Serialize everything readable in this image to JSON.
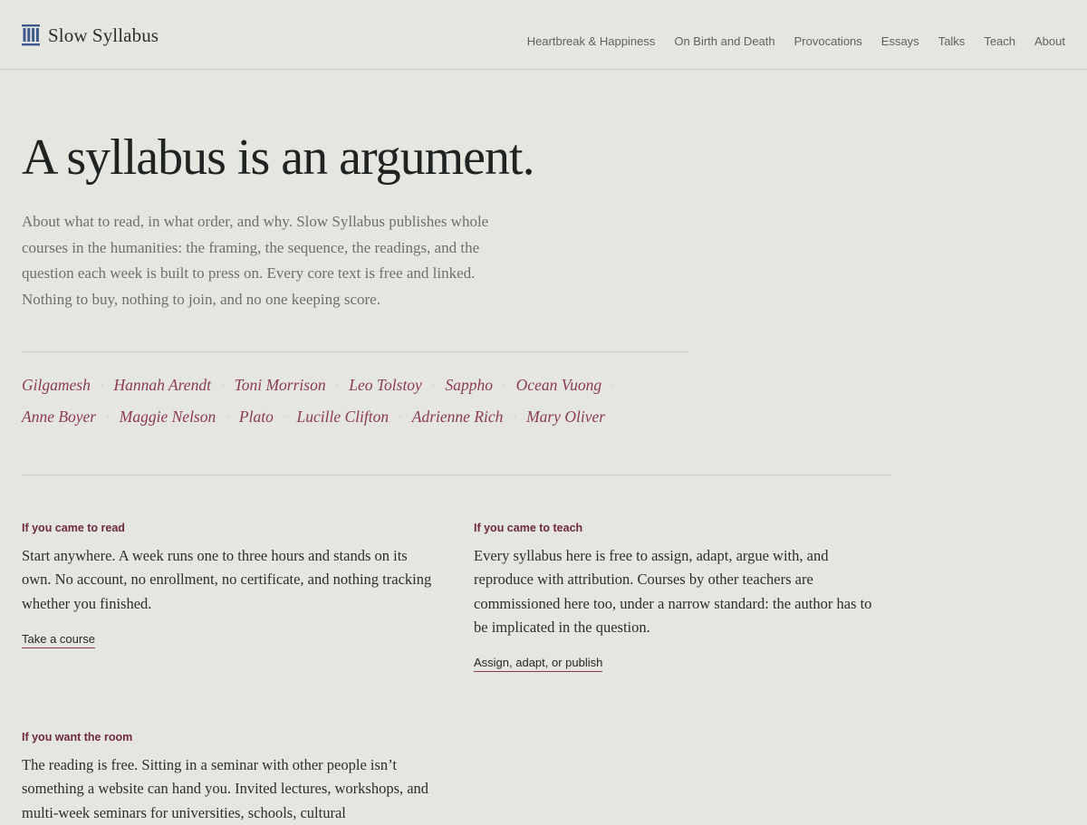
{
  "header": {
    "logo_text": "Slow Syllabus",
    "logo_icon": "columns-icon",
    "nav": [
      "Heartbreak & Happiness",
      "On Birth and Death",
      "Provocations",
      "Essays",
      "Talks",
      "Teach",
      "About"
    ]
  },
  "hero": {
    "title": "A syllabus is an argument.",
    "intro": "About what to read, in what order, and why. Slow Syllabus publishes whole courses in the humanities: the framing, the sequence, the readings, and the question each week is built to press on. Every core text is free and linked. Nothing to buy, nothing to join, and no one keeping score."
  },
  "authors": {
    "row1": [
      "Gilgamesh",
      "Hannah Arendt",
      "Toni Morrison",
      "Leo Tolstoy",
      "Sappho",
      "Ocean Vuong"
    ],
    "row2": [
      "Anne Boyer",
      "Maggie Nelson",
      "Plato",
      "Lucille Clifton",
      "Adrienne Rich",
      "Mary Oliver"
    ],
    "separator": "·"
  },
  "sections": {
    "read": {
      "label": "If you came to read",
      "body": "Start anywhere. A week runs one to three hours and stands on its own. No account, no enrollment, no certificate, and nothing tracking whether you finished.",
      "link": "Take a course"
    },
    "teach": {
      "label": "If you came to teach",
      "body": "Every syllabus here is free to assign, adapt, argue with, and reproduce with attribution. Courses by other teachers are commissioned here too, under a narrow standard: the author has to be implicated in the question.",
      "link": "Assign, adapt, or publish"
    },
    "room": {
      "label": "If you want the room",
      "body": "The reading is free. Sitting in a seminar with other people isn’t something a website can hand you. Invited lectures, workshops, and multi-week seminars for universities, schools, cultural"
    }
  },
  "colors": {
    "background": "#e6e6e1",
    "accent": "#8b3a55",
    "label": "#6e2a3c",
    "logo": "#3e5a8c"
  }
}
